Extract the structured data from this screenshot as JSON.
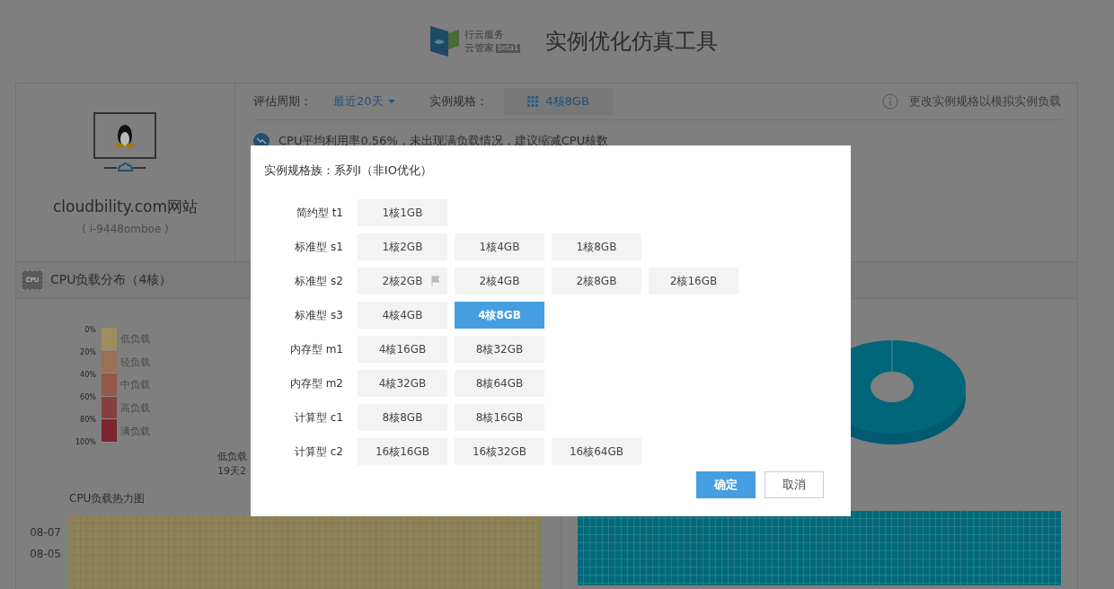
{
  "header": {
    "logo_line1": "行云服务",
    "logo_line2": "云管家",
    "logo_badge": "beta1",
    "title": "实例优化仿真工具"
  },
  "instance": {
    "name": "cloudbility.com网站",
    "id": "( i-9448omboe )"
  },
  "toolbar": {
    "period_label": "评估周期：",
    "period_value": "最近20天",
    "spec_label": "实例规格：",
    "spec_value": "4核8GB",
    "hint": "更改实例规格以模拟实例负载"
  },
  "summary": "CPU平均利用率0.56%，未出现满负载情况，建议缩减CPU核数",
  "cpu_section": {
    "title": "CPU负载分布（4核）",
    "icon_text": "CPU",
    "legend": [
      {
        "tick": "0%",
        "label": "低负载",
        "color": "#a08d5e"
      },
      {
        "tick": "20%",
        "label": "轻负载",
        "color": "#9a7155"
      },
      {
        "tick": "40%",
        "label": "中负载",
        "color": "#93584b"
      },
      {
        "tick": "60%",
        "label": "高负载",
        "color": "#893f40"
      },
      {
        "tick": "80%",
        "label": "满负载",
        "color": "#7c2630"
      }
    ],
    "final_tick": "100%",
    "pie_label": "低负载",
    "pie_value": "19天2",
    "heatmap_title": "CPU负载热力图",
    "heatmap_rows": [
      "08-07",
      "08-05"
    ]
  },
  "dialog": {
    "title": "实例规格族：系列I（非IO优化）",
    "families": [
      {
        "label": "简约型 t1",
        "options": [
          {
            "text": "1核1GB",
            "selected": false,
            "flagged": false
          }
        ]
      },
      {
        "label": "标准型 s1",
        "options": [
          {
            "text": "1核2GB",
            "selected": false,
            "flagged": false
          },
          {
            "text": "1核4GB",
            "selected": false,
            "flagged": false
          },
          {
            "text": "1核8GB",
            "selected": false,
            "flagged": false
          }
        ]
      },
      {
        "label": "标准型 s2",
        "options": [
          {
            "text": "2核2GB",
            "selected": false,
            "flagged": true
          },
          {
            "text": "2核4GB",
            "selected": false,
            "flagged": false
          },
          {
            "text": "2核8GB",
            "selected": false,
            "flagged": false
          },
          {
            "text": "2核16GB",
            "selected": false,
            "flagged": false
          }
        ]
      },
      {
        "label": "标准型 s3",
        "options": [
          {
            "text": "4核4GB",
            "selected": false,
            "flagged": false
          },
          {
            "text": "4核8GB",
            "selected": true,
            "flagged": false
          }
        ]
      },
      {
        "label": "内存型 m1",
        "options": [
          {
            "text": "4核16GB",
            "selected": false,
            "flagged": false
          },
          {
            "text": "8核32GB",
            "selected": false,
            "flagged": false
          }
        ]
      },
      {
        "label": "内存型 m2",
        "options": [
          {
            "text": "4核32GB",
            "selected": false,
            "flagged": false
          },
          {
            "text": "8核64GB",
            "selected": false,
            "flagged": false
          }
        ]
      },
      {
        "label": "计算型 c1",
        "options": [
          {
            "text": "8核8GB",
            "selected": false,
            "flagged": false
          },
          {
            "text": "8核16GB",
            "selected": false,
            "flagged": false
          }
        ]
      },
      {
        "label": "计算型 c2",
        "options": [
          {
            "text": "16核16GB",
            "selected": false,
            "flagged": false
          },
          {
            "text": "16核32GB",
            "selected": false,
            "flagged": false
          },
          {
            "text": "16核64GB",
            "selected": false,
            "flagged": false
          }
        ]
      }
    ],
    "confirm": "确定",
    "cancel": "取消"
  }
}
